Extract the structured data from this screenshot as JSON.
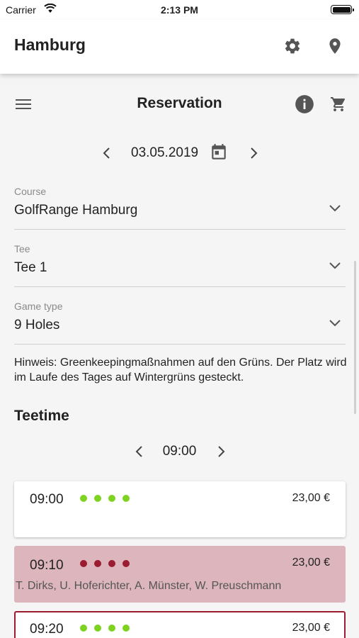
{
  "status_bar": {
    "carrier": "Carrier",
    "time": "2:13 PM"
  },
  "header": {
    "city": "Hamburg"
  },
  "reservation": {
    "title": "Reservation"
  },
  "date_nav": {
    "date": "03.05.2019"
  },
  "fields": {
    "course": {
      "label": "Course",
      "value": "GolfRange Hamburg"
    },
    "tee": {
      "label": "Tee",
      "value": "Tee 1"
    },
    "game_type": {
      "label": "Game type",
      "value": "9 Holes"
    }
  },
  "notice": "Hinweis: Greenkeepingmaßnahmen auf den Grüns. Der Platz wird im Laufe des Tages auf Wintergrüns gesteckt.",
  "teetime": {
    "title": "Teetime",
    "time": "09:00"
  },
  "slots": [
    {
      "time": "09:00",
      "price": "23,00 €",
      "players": "",
      "status": "available"
    },
    {
      "time": "09:10",
      "price": "23,00 €",
      "players": "T. Dirks, U. Hoferichter, A. Münster, W. Preuschmann",
      "status": "booked"
    },
    {
      "time": "09:20",
      "price": "23,00 €",
      "players": "",
      "status": "selected"
    }
  ],
  "colors": {
    "dot_available": "#7ed321",
    "dot_booked": "#9b1b30",
    "booked_bg": "#dcb5bd",
    "selected_border": "#9b1b30",
    "icon_gray": "#555555"
  }
}
